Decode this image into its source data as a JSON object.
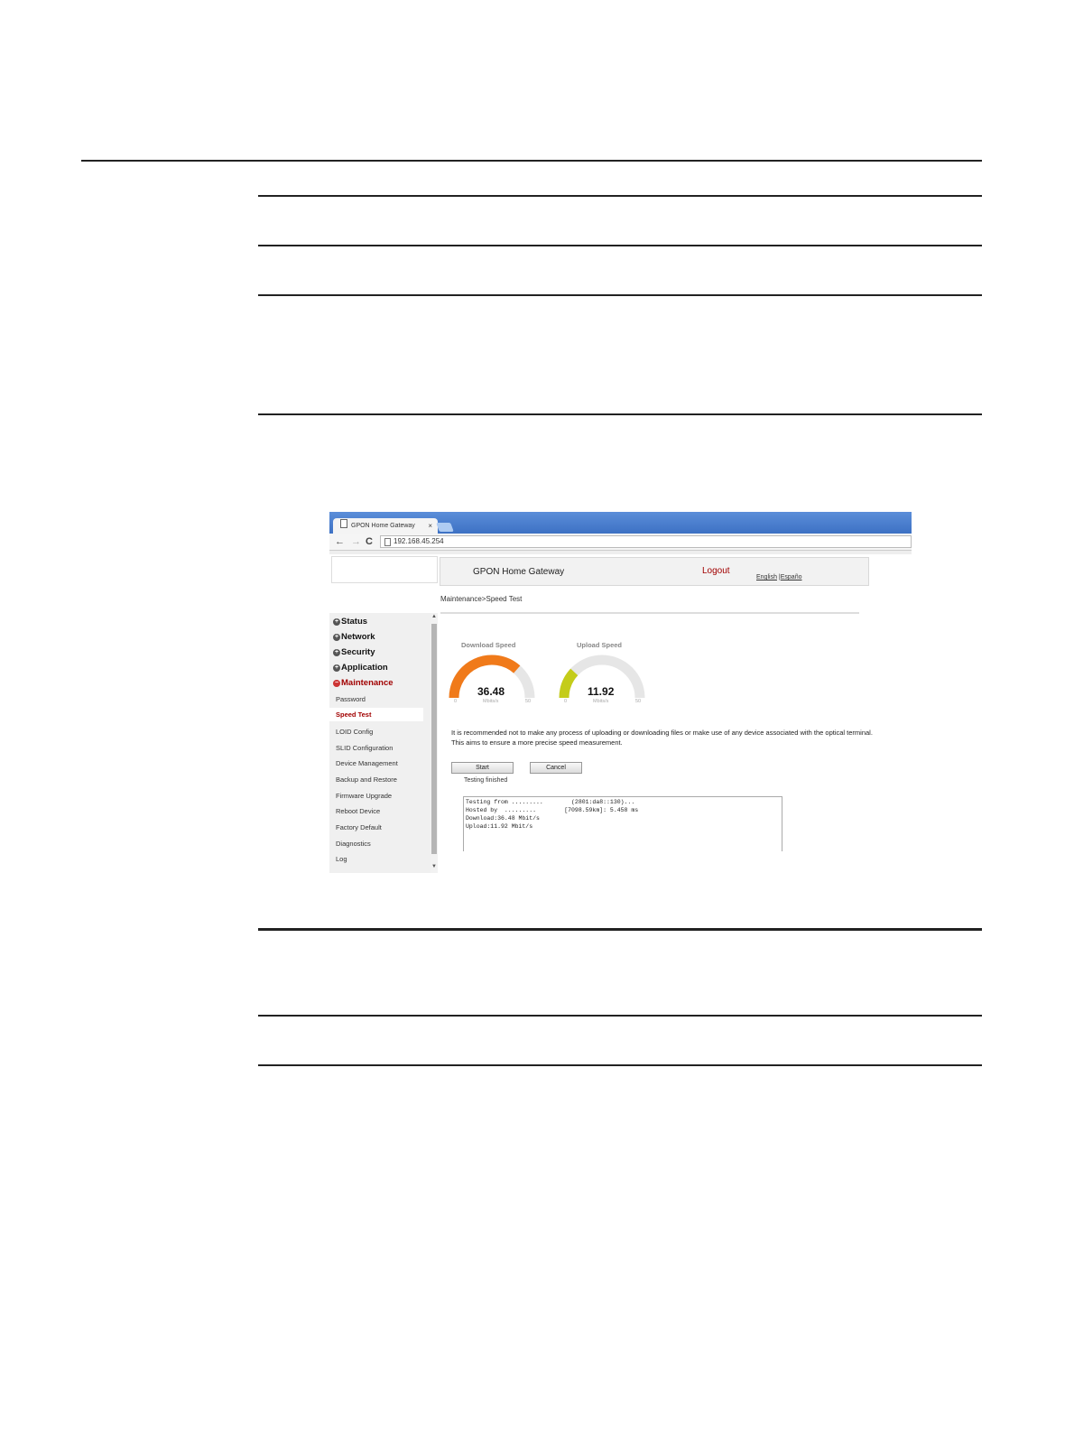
{
  "browser": {
    "tab_title": "GPON Home Gateway",
    "tab_close": "×",
    "url": "192.168.45.254",
    "back": "←",
    "forward": "→",
    "reload": "C"
  },
  "header": {
    "title": "GPON Home Gateway",
    "logout": "Logout",
    "lang_english": "English",
    "lang_sep": "|",
    "lang_spanish": "Españo"
  },
  "breadcrumb": "Maintenance>Speed Test",
  "sidebar": {
    "menus": [
      "Status",
      "Network",
      "Security",
      "Application",
      "Maintenance"
    ],
    "active_menu": "Maintenance",
    "sub_items": [
      "Password",
      "Speed Test",
      "LOID Config",
      "SLID Configuration",
      "Device Management",
      "Backup and Restore",
      "Firmware Upgrade",
      "Reboot Device",
      "Factory Default",
      "Diagnostics",
      "Log"
    ],
    "selected_sub": "Speed Test"
  },
  "gauges": {
    "download": {
      "label": "Download Speed",
      "value": "36.48",
      "numeric": 36.48,
      "min": "0",
      "max": "50",
      "unit": "Mbits/s",
      "color": "#f07a1a"
    },
    "upload": {
      "label": "Upload Speed",
      "value": "11.92",
      "numeric": 11.92,
      "min": "0",
      "max": "50",
      "unit": "Mbits/s",
      "color": "#c4cc1a"
    }
  },
  "notes": {
    "line1": "It is recommended not to make any process of uploading or downloading files or make use of any device associated with the optical terminal.",
    "line2": "This aims to ensure a more precise speed measurement."
  },
  "buttons": {
    "start": "Start",
    "cancel": "Cancel"
  },
  "status_text": "Testing finished",
  "log_lines": [
    "Testing from .........        (2801:da8::130)...",
    "Hosted by  .........        [7098.59km]: 5.458 ms",
    "Download:36.48 Mbit/s",
    "Upload:11.92 Mbit/s"
  ]
}
